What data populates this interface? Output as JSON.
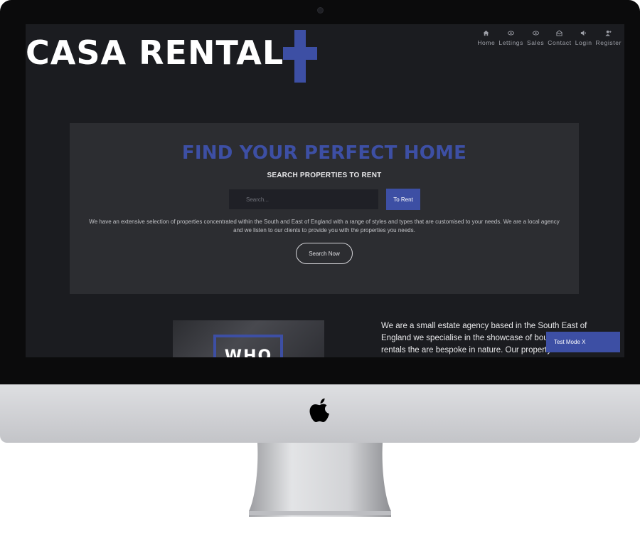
{
  "brand": {
    "logo_text": "CASA RENTAL",
    "accent_color": "#3d4fa4"
  },
  "nav": {
    "items": [
      {
        "label": "Home",
        "icon": "home-icon"
      },
      {
        "label": "Lettings",
        "icon": "eye-icon"
      },
      {
        "label": "Sales",
        "icon": "eye-icon"
      },
      {
        "label": "Contact",
        "icon": "envelope-icon"
      },
      {
        "label": "Login",
        "icon": "speaker-icon"
      },
      {
        "label": "Register",
        "icon": "user-add-icon"
      }
    ]
  },
  "hero": {
    "title": "FIND YOUR PERFECT HOME",
    "subtitle": "SEARCH PROPERTIES TO RENT",
    "search_placeholder": "Search...",
    "rent_button": "To Rent",
    "description": "We have an extensive selection of properties concentrated within the South and East of England with a range of styles and types that are customised to your needs. We are a local agency and we listen to our clients to provide you with the properties you needs.",
    "search_button": "Search Now"
  },
  "who": {
    "label": "WHO"
  },
  "about": {
    "text": "We are a small estate agency based in the South East of England we specialise in the showcase of boutique rentals the are bespoke in nature. Our property se"
  },
  "test_mode": {
    "label": "Test Mode X"
  }
}
